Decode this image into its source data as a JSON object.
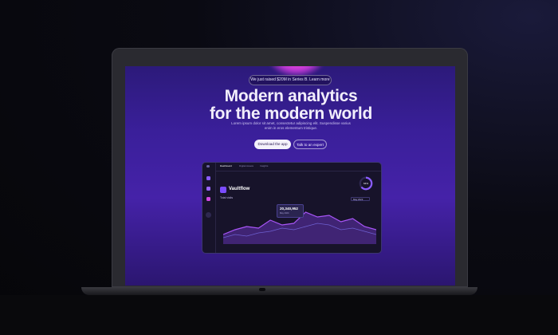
{
  "hero": {
    "announcement": "We just raised $20M in Series B. Learn more",
    "headline_line1": "Modern analytics",
    "headline_line2": "for the modern world",
    "subtext": "Lorem ipsum dolor sit amet, consectetur adipiscing elit. Suspendisse varius enim in eros elementum tristique.",
    "primary_button": "Download the app",
    "secondary_button": "Talk to an expert"
  },
  "dashboard": {
    "tabs": [
      "Dashboard",
      "Digital Assets",
      "Insights"
    ],
    "brand": "Vaultflow",
    "section_label": "Total visits",
    "tooltip_value": "20,340,952",
    "tooltip_sub": "May 2024",
    "ring_value": "64%",
    "month_select": "May 2023"
  },
  "colors": {
    "accent": "#7b4cff",
    "pink": "#ff4fd8",
    "bg": "#17132a"
  },
  "chart_data": {
    "type": "area",
    "series": [
      {
        "values": [
          12,
          18,
          22,
          20,
          30,
          24,
          26,
          40,
          34,
          36,
          28,
          32,
          22,
          18
        ]
      },
      {
        "values": [
          8,
          12,
          10,
          14,
          16,
          20,
          18,
          22,
          26,
          24,
          18,
          20,
          16,
          12
        ]
      }
    ]
  }
}
